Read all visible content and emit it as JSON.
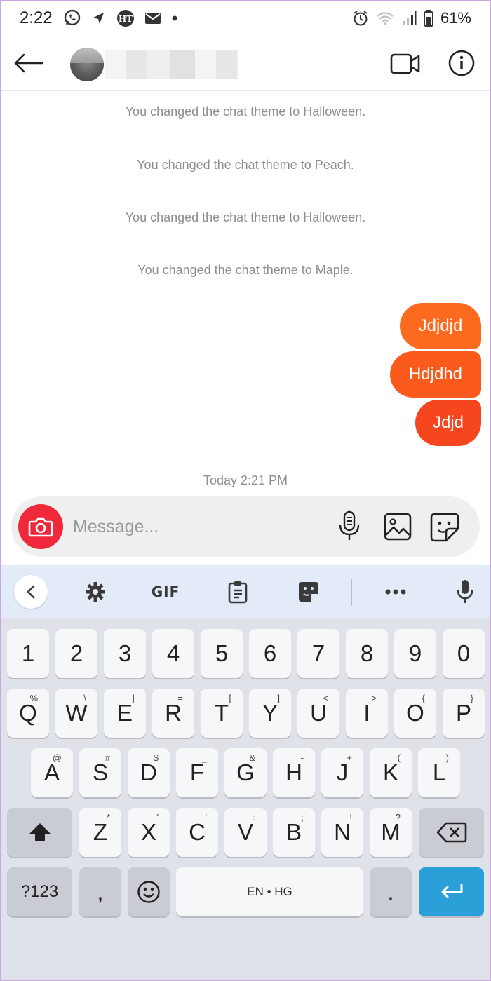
{
  "status_bar": {
    "time": "2:22",
    "battery": "61%",
    "icons": [
      "whatsapp-icon",
      "navigation-icon",
      "ht-news-icon",
      "mail-icon",
      "dot-icon",
      "alarm-icon",
      "wifi-icon",
      "signal-icon",
      "battery-icon"
    ]
  },
  "header": {
    "icons": [
      "back-arrow-icon",
      "avatar",
      "video-call-icon",
      "info-icon"
    ]
  },
  "chat": {
    "system_messages": [
      "You changed the chat theme to Halloween.",
      "You changed the chat theme to Peach.",
      "You changed the chat theme to Halloween.",
      "You changed the chat theme to Maple."
    ],
    "sent_messages": [
      "Jdjdjd",
      "Hdjdhd",
      "Jdjd"
    ],
    "timestamp": "Today 2:21 PM",
    "bubble_colors": [
      "#fb6a1e",
      "#fa5a1c",
      "#f6461e"
    ]
  },
  "composer": {
    "placeholder": "Message...",
    "icons": [
      "camera-icon",
      "microphone-icon",
      "gallery-icon",
      "sticker-icon"
    ]
  },
  "keyboard": {
    "toolbar": {
      "gif_label": "GIF",
      "icons": [
        "chevron-left-icon",
        "settings-gear-icon",
        "clipboard-icon",
        "sticker-icon",
        "more-icon",
        "voice-mic-icon"
      ]
    },
    "rows": {
      "numbers": [
        "1",
        "2",
        "3",
        "4",
        "5",
        "6",
        "7",
        "8",
        "9",
        "0"
      ],
      "top": [
        {
          "key": "Q",
          "hint": "%"
        },
        {
          "key": "W",
          "hint": "\\"
        },
        {
          "key": "E",
          "hint": "|"
        },
        {
          "key": "R",
          "hint": "="
        },
        {
          "key": "T",
          "hint": "["
        },
        {
          "key": "Y",
          "hint": "]"
        },
        {
          "key": "U",
          "hint": "<"
        },
        {
          "key": "I",
          "hint": ">"
        },
        {
          "key": "O",
          "hint": "{"
        },
        {
          "key": "P",
          "hint": "}"
        }
      ],
      "middle": [
        {
          "key": "A",
          "hint": "@"
        },
        {
          "key": "S",
          "hint": "#"
        },
        {
          "key": "D",
          "hint": "$"
        },
        {
          "key": "F",
          "hint": "_"
        },
        {
          "key": "G",
          "hint": "&"
        },
        {
          "key": "H",
          "hint": "-"
        },
        {
          "key": "J",
          "hint": "+"
        },
        {
          "key": "K",
          "hint": "("
        },
        {
          "key": "L",
          "hint": ")"
        }
      ],
      "bottom": [
        {
          "key": "Z",
          "hint": "*"
        },
        {
          "key": "X",
          "hint": "\""
        },
        {
          "key": "C",
          "hint": "'"
        },
        {
          "key": "V",
          "hint": ":"
        },
        {
          "key": "B",
          "hint": ";"
        },
        {
          "key": "N",
          "hint": "!"
        },
        {
          "key": "M",
          "hint": "?"
        }
      ]
    },
    "symbols_label": "?123",
    "comma_label": ",",
    "space_label": "EN • HG",
    "period_label": ".",
    "accent_color": "#2a9fd8"
  }
}
